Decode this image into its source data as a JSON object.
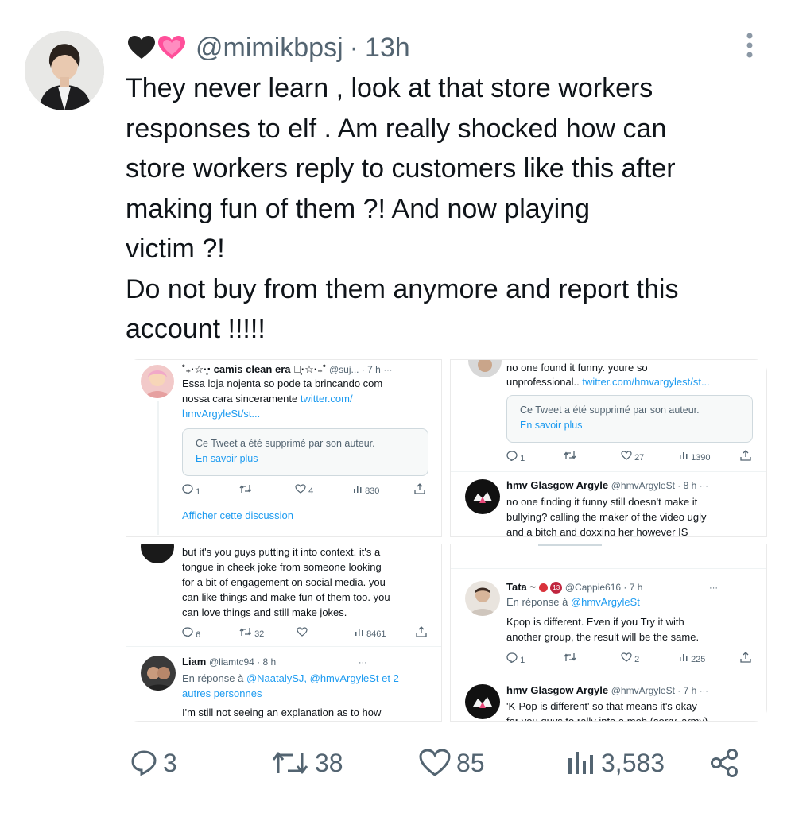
{
  "author": {
    "handle": "@mimikbpsj",
    "time_sep": "·",
    "time": "13h"
  },
  "tweet": {
    "text": "They never learn , look at that store workers\nresponses to elf . Am really shocked how can\nstore workers reply to customers like  this after\nmaking fun of them ?!  And now playing\nvictim ?!\nDo not buy from them anymore and report this\naccount  !!!!!"
  },
  "icons": {
    "heart_black": "black-heart-icon",
    "heart_pink": "sparkling-heart-icon",
    "more": "more-vertical-icon"
  },
  "colors": {
    "text": "#0f1419",
    "secondary": "#536471",
    "link": "#1d9bf0",
    "heart_pink": "#ff4f9a",
    "heart_black": "#222222"
  },
  "panel1": {
    "name": "˚₊·☆·͙̥‧ camis clean era ‧͙̥·☆·₊˚",
    "handle_time": "@suj... · 7 h",
    "dots": "···",
    "line1": "Essa loja nojenta so pode ta brincando com",
    "line2a": "nossa cara sinceramente ",
    "line2b": "twitter.com/",
    "line3": "hmvArgyleSt/st...",
    "quote1": "Ce Tweet a été supprimé par son auteur.",
    "quote2": "En savoir plus",
    "replies": "1",
    "likes": "4",
    "views": "830",
    "show_thread": "Afficher cette discussion"
  },
  "panel2": {
    "line1": "no one found it funny. youre so",
    "line2a": "unprofessional.. ",
    "line2b": "twitter.com/hmvargylest/st...",
    "quote1": "Ce Tweet a été supprimé par son auteur.",
    "quote2": "En savoir plus",
    "replies": "1",
    "likes": "27",
    "views": "1390",
    "name": "hmv Glasgow Argyle",
    "handle_time": "@hmvArgyleSt · 8 h",
    "dots": "···",
    "r1": "no one finding it funny still doesn't make it",
    "r2": "bullying? calling the maker of the video ugly",
    "r3": "and a bitch and doxxing her however IS"
  },
  "panel3": {
    "line1": "but it's you guys putting it into context. it's a",
    "line2": "tongue in cheek joke from someone looking",
    "line3": "for a bit of engagement on social media. you",
    "line4": "can like things and make fun of them too. you",
    "line5": "can love things and still make jokes.",
    "replies": "6",
    "retweets": "32",
    "views": "8461",
    "name": "Liam",
    "handle_time": "@liamtc94 · 8 h",
    "dots": "···",
    "reply_prefix": "En réponse à ",
    "reply_users": "@NaatalySJ, @hmvArgyleSt et 2",
    "reply_users2": "autres personnes",
    "r1": "I'm still not seeing an explanation as to how"
  },
  "panel4": {
    "name": "Tata ~",
    "badge": "13",
    "handle_time": "@Cappie616 · 7 h",
    "dots": "···",
    "reply_prefix": "En réponse à ",
    "reply_user": "@hmvArgyleSt",
    "line1": "Kpop is different. Even if you Try it with",
    "line2": "another group, the result will be the same.",
    "replies": "1",
    "likes": "2",
    "views": "225",
    "name2": "hmv Glasgow Argyle",
    "handle_time2": "@hmvArgyleSt · 7 h",
    "r1": "'K-Pop is different' so that means it's okay",
    "r2": "for you guys to rally into a mob (sorry, army)"
  },
  "actions": {
    "replies": "3",
    "retweets": "38",
    "likes": "85",
    "views": "3,583"
  }
}
